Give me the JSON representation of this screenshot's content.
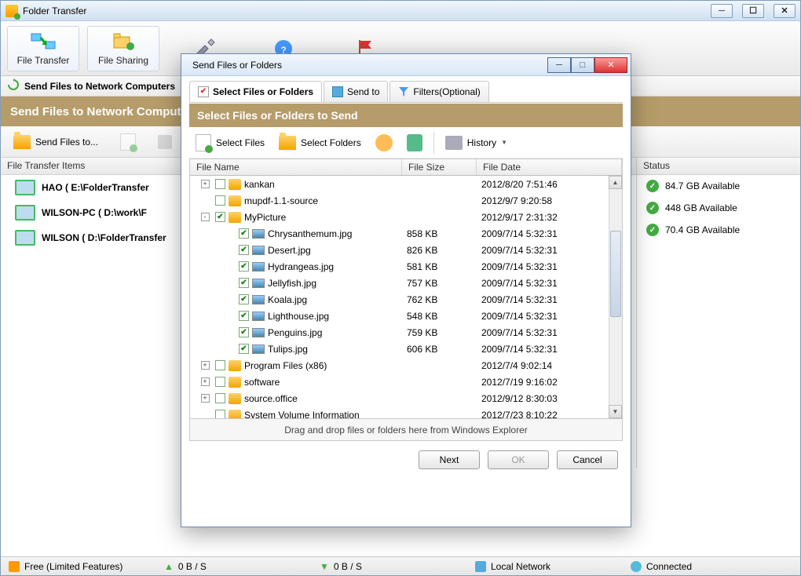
{
  "main": {
    "title": "Folder Transfer",
    "toolbar": [
      {
        "label": "File Transfer"
      },
      {
        "label": "File Sharing"
      }
    ],
    "substrip_label": "Send Files to Network Computers",
    "banner": "Send Files to Network Computers",
    "toolbar2_send_files": "Send Files to...",
    "left_header": "File Transfer Items",
    "right_header": "Status",
    "left_items": [
      {
        "label": "HAO ( E:\\FolderTransfer"
      },
      {
        "label": "WILSON-PC ( D:\\work\\F"
      },
      {
        "label": "WILSON ( D:\\FolderTransfer"
      }
    ],
    "right_items": [
      {
        "label": "84.7 GB Available"
      },
      {
        "label": "448 GB Available"
      },
      {
        "label": "70.4 GB Available"
      }
    ],
    "status": {
      "s1": "Free (Limited Features)",
      "s2": "0 B / S",
      "s3": "0 B / S",
      "s4": "Local Network",
      "s5": "Connected"
    }
  },
  "dialog": {
    "title": "Send Files or Folders",
    "tabs": [
      {
        "label": "Select Files or Folders"
      },
      {
        "label": "Send to"
      },
      {
        "label": "Filters(Optional)"
      }
    ],
    "banner": "Select Files or Folders to Send",
    "toolbar": {
      "select_files": "Select Files",
      "select_folders": "Select Folders",
      "history": "History"
    },
    "columns": {
      "c1": "File Name",
      "c2": "File Size",
      "c3": "File Date"
    },
    "rows": [
      {
        "indent": 0,
        "exp": "+",
        "checked": false,
        "type": "folder",
        "name": "kankan",
        "size": "",
        "date": "2012/8/20 7:51:46"
      },
      {
        "indent": 0,
        "exp": "",
        "checked": false,
        "type": "folder",
        "name": "mupdf-1.1-source",
        "size": "",
        "date": "2012/9/7 9:20:58"
      },
      {
        "indent": 0,
        "exp": "-",
        "checked": true,
        "type": "folder",
        "name": "MyPicture",
        "size": "",
        "date": "2012/9/17 2:31:32"
      },
      {
        "indent": 1,
        "exp": "",
        "checked": true,
        "type": "image",
        "name": "Chrysanthemum.jpg",
        "size": "858 KB",
        "date": "2009/7/14 5:32:31"
      },
      {
        "indent": 1,
        "exp": "",
        "checked": true,
        "type": "image",
        "name": "Desert.jpg",
        "size": "826 KB",
        "date": "2009/7/14 5:32:31"
      },
      {
        "indent": 1,
        "exp": "",
        "checked": true,
        "type": "image",
        "name": "Hydrangeas.jpg",
        "size": "581 KB",
        "date": "2009/7/14 5:32:31"
      },
      {
        "indent": 1,
        "exp": "",
        "checked": true,
        "type": "image",
        "name": "Jellyfish.jpg",
        "size": "757 KB",
        "date": "2009/7/14 5:32:31"
      },
      {
        "indent": 1,
        "exp": "",
        "checked": true,
        "type": "image",
        "name": "Koala.jpg",
        "size": "762 KB",
        "date": "2009/7/14 5:32:31"
      },
      {
        "indent": 1,
        "exp": "",
        "checked": true,
        "type": "image",
        "name": "Lighthouse.jpg",
        "size": "548 KB",
        "date": "2009/7/14 5:32:31"
      },
      {
        "indent": 1,
        "exp": "",
        "checked": true,
        "type": "image",
        "name": "Penguins.jpg",
        "size": "759 KB",
        "date": "2009/7/14 5:32:31"
      },
      {
        "indent": 1,
        "exp": "",
        "checked": true,
        "type": "image",
        "name": "Tulips.jpg",
        "size": "606 KB",
        "date": "2009/7/14 5:32:31"
      },
      {
        "indent": 0,
        "exp": "+",
        "checked": false,
        "type": "folder",
        "name": "Program Files (x86)",
        "size": "",
        "date": "2012/7/4 9:02:14"
      },
      {
        "indent": 0,
        "exp": "+",
        "checked": false,
        "type": "folder",
        "name": "software",
        "size": "",
        "date": "2012/7/19 9:16:02"
      },
      {
        "indent": 0,
        "exp": "+",
        "checked": false,
        "type": "folder",
        "name": "source.office",
        "size": "",
        "date": "2012/9/12 8:30:03"
      },
      {
        "indent": 0,
        "exp": "",
        "checked": false,
        "type": "folder",
        "name": "System Volume Information",
        "size": "",
        "date": "2012/7/23 8:10:22"
      }
    ],
    "droptext": "Drag and drop files or folders here from Windows Explorer",
    "buttons": {
      "next": "Next",
      "ok": "OK",
      "cancel": "Cancel"
    }
  }
}
